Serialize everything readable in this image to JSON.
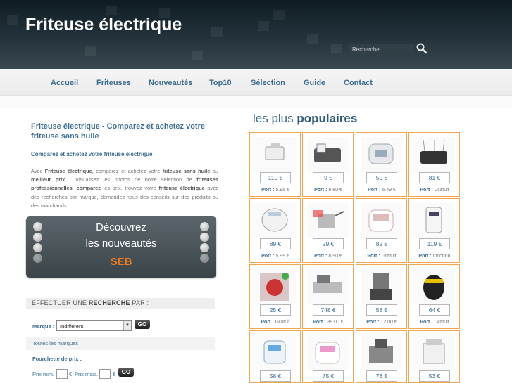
{
  "header": {
    "title": "Friteuse électrique",
    "search_placeholder": "Recherche"
  },
  "nav": [
    {
      "label": "Accueil"
    },
    {
      "label": "Friteuses"
    },
    {
      "label": "Nouveautés"
    },
    {
      "label": "Top10"
    },
    {
      "label": "Sélection"
    },
    {
      "label": "Guide"
    },
    {
      "label": "Contact"
    }
  ],
  "intro": {
    "title": "Friteuse électrique - Comparez et achetez votre friteuse sans huile",
    "subtitle": "Comparez et achetez votre friteuse électrique",
    "t1": "Avec ",
    "b1": "Friteuse électrique",
    "t2": ", comparez et achetez votre ",
    "b2": "friteuse sans huile",
    "t3": " au ",
    "b3": "meilleur prix",
    "t4": " ! Visualisez les photos de notre sélection de ",
    "b4": "friteuses professionnelles",
    "t5": ", ",
    "b5": "comparez",
    "t6": " les prix, trouvez votre ",
    "b6": "friteuse électrique",
    "t7": " avec des recherches par marque, demandez-nous des conseils sur des produits ou des marchands..."
  },
  "promo": {
    "line1": "Découvrez",
    "line2": "les nouveautés",
    "brand": "SEB"
  },
  "search": {
    "heading_prefix": "EFFECTUER UNE ",
    "heading_bold": "RECHERCHE",
    "heading_suffix": " PAR :",
    "brand_label": "Marque :",
    "brand_value": "Indifférent",
    "go": "GO",
    "all_brands": "Toutes les marques",
    "price_range_label": "Fourchette de prix :",
    "min_label": "Prix mini.",
    "euro": "€",
    "max_label": "Prix maxi."
  },
  "popular": {
    "title_light": "les plus ",
    "title_bold": "populaires",
    "port_label": "Port :",
    "products": [
      {
        "price": "110 €",
        "port": "5.95 €"
      },
      {
        "price": "9 €",
        "port": "8.80 €"
      },
      {
        "price": "59 €",
        "port": "6.49 €"
      },
      {
        "price": "81 €",
        "port": "Gratuit"
      },
      {
        "price": "89 €",
        "port": "5.99 €"
      },
      {
        "price": "29 €",
        "port": "8.90 €"
      },
      {
        "price": "82 €",
        "port": "Gratuit"
      },
      {
        "price": "119 €",
        "port": "Inconnu"
      },
      {
        "price": "25 €",
        "port": "Gratuit"
      },
      {
        "price": "748 €",
        "port": "39.00 €"
      },
      {
        "price": "58 €",
        "port": "12.00 €"
      },
      {
        "price": "64 €",
        "port": "Gratuit"
      },
      {
        "price": "58 €",
        "port": ""
      },
      {
        "price": "75 €",
        "port": ""
      },
      {
        "price": "78 €",
        "port": ""
      },
      {
        "price": "53 €",
        "port": ""
      }
    ]
  },
  "colors": {
    "accent": "#3d6e92",
    "card_border": "#f3a64e",
    "promo_brand": "#f07b1c",
    "header_dark": "#1c2a32"
  }
}
